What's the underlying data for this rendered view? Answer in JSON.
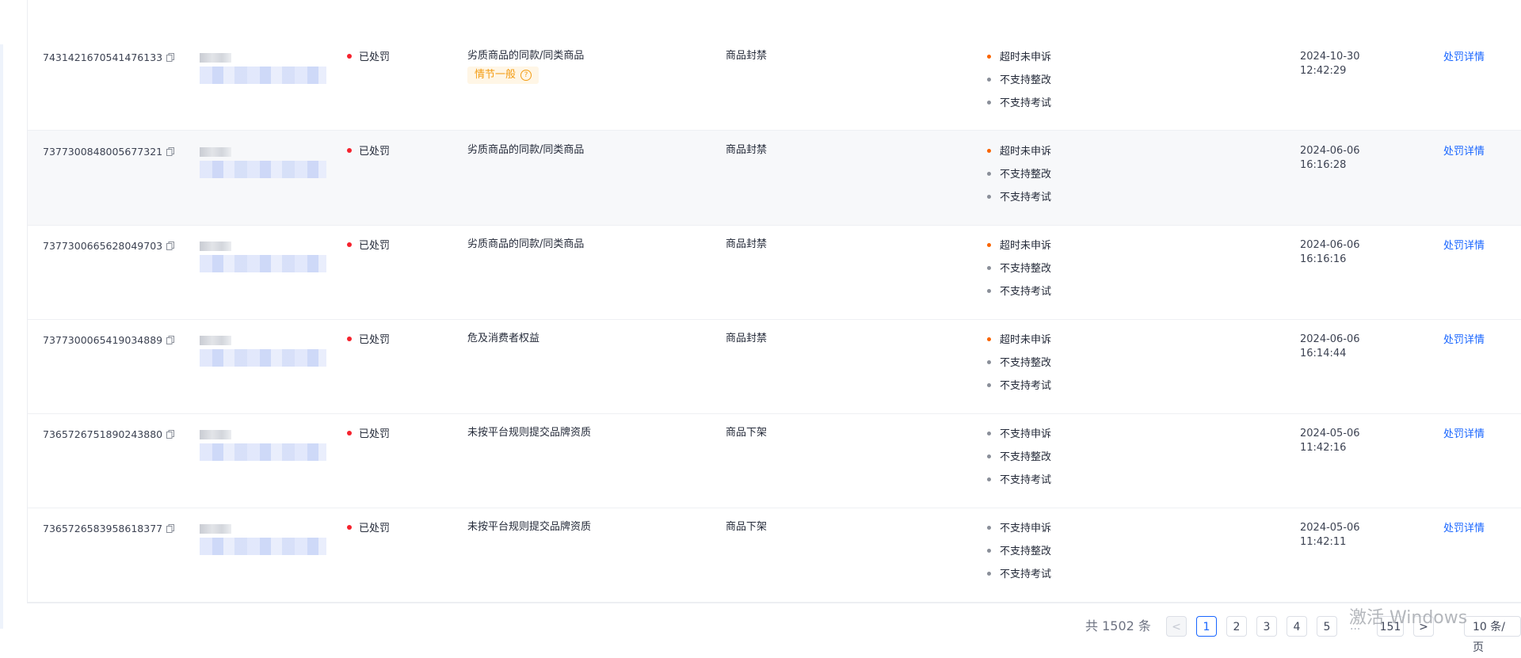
{
  "colors": {
    "link": "#1966ff",
    "status_red": "#f5222d",
    "orange": "#fa6400",
    "gray": "#8a8f99",
    "tag_bg": "#fff6e6",
    "tag_fg": "#f39c12"
  },
  "rows": [
    {
      "id": "7431421670541476133",
      "status": "已处罚",
      "reason": "劣质商品的同款/同类商品",
      "tag": "情节一般",
      "penalty": "商品封禁",
      "rights": [
        {
          "label": "超时未申诉",
          "color": "orange"
        },
        {
          "label": "不支持整改",
          "color": "gray"
        },
        {
          "label": "不支持考试",
          "color": "gray"
        }
      ],
      "date": "2024-10-30",
      "time": "12:42:29",
      "action": "处罚详情"
    },
    {
      "id": "7377300848005677321",
      "status": "已处罚",
      "reason": "劣质商品的同款/同类商品",
      "tag": null,
      "penalty": "商品封禁",
      "rights": [
        {
          "label": "超时未申诉",
          "color": "orange"
        },
        {
          "label": "不支持整改",
          "color": "gray"
        },
        {
          "label": "不支持考试",
          "color": "gray"
        }
      ],
      "date": "2024-06-06",
      "time": "16:16:28",
      "action": "处罚详情"
    },
    {
      "id": "7377300665628049703",
      "status": "已处罚",
      "reason": "劣质商品的同款/同类商品",
      "tag": null,
      "penalty": "商品封禁",
      "rights": [
        {
          "label": "超时未申诉",
          "color": "orange"
        },
        {
          "label": "不支持整改",
          "color": "gray"
        },
        {
          "label": "不支持考试",
          "color": "gray"
        }
      ],
      "date": "2024-06-06",
      "time": "16:16:16",
      "action": "处罚详情"
    },
    {
      "id": "7377300065419034889",
      "status": "已处罚",
      "reason": "危及消费者权益",
      "tag": null,
      "penalty": "商品封禁",
      "rights": [
        {
          "label": "超时未申诉",
          "color": "orange"
        },
        {
          "label": "不支持整改",
          "color": "gray"
        },
        {
          "label": "不支持考试",
          "color": "gray"
        }
      ],
      "date": "2024-06-06",
      "time": "16:14:44",
      "action": "处罚详情"
    },
    {
      "id": "7365726751890243880",
      "status": "已处罚",
      "reason": "未按平台规则提交品牌资质",
      "tag": null,
      "penalty": "商品下架",
      "rights": [
        {
          "label": "不支持申诉",
          "color": "gray"
        },
        {
          "label": "不支持整改",
          "color": "gray"
        },
        {
          "label": "不支持考试",
          "color": "gray"
        }
      ],
      "date": "2024-05-06",
      "time": "11:42:16",
      "action": "处罚详情"
    },
    {
      "id": "7365726583958618377",
      "status": "已处罚",
      "reason": "未按平台规则提交品牌资质",
      "tag": null,
      "penalty": "商品下架",
      "rights": [
        {
          "label": "不支持申诉",
          "color": "gray"
        },
        {
          "label": "不支持整改",
          "color": "gray"
        },
        {
          "label": "不支持考试",
          "color": "gray"
        }
      ],
      "date": "2024-05-06",
      "time": "11:42:11",
      "action": "处罚详情"
    }
  ],
  "pagination": {
    "total_label": "共 1502 条",
    "prev": "<",
    "pages": [
      "1",
      "2",
      "3",
      "4",
      "5"
    ],
    "current": "1",
    "ellipsis": "...",
    "last": "151",
    "next": ">",
    "page_size": "10 条/页"
  },
  "watermark": "激活 Windows"
}
